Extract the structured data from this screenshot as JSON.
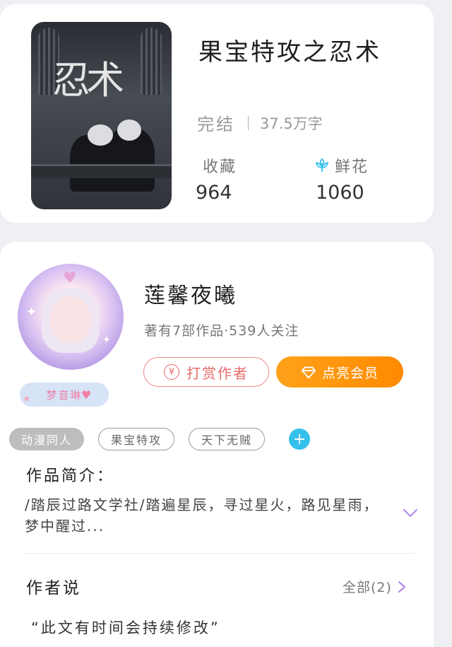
{
  "book": {
    "title": "果宝特攻之忍术",
    "status": "完结",
    "word_count": "37.5万字",
    "favorites_label": "收藏",
    "favorites_count": "964",
    "flowers_label": "鲜花",
    "flowers_count": "1060",
    "cover_title": "忍术"
  },
  "author": {
    "name": "莲馨夜曦",
    "meta": "著有7部作品·539人关注",
    "badge": "梦音琳",
    "tip_button": "打赏作者",
    "vip_button": "点亮会员"
  },
  "tags": [
    "动漫同人",
    "果宝特攻",
    "天下无贼"
  ],
  "intro": {
    "label": "作品简介：",
    "text": "/踏辰过路文学社/踏遍星辰，寻过星火，路见星雨，梦中醒过..."
  },
  "author_says": {
    "label": "作者说",
    "all_link": "全部(2)",
    "quote": "“此文有时间会持续修改”"
  },
  "colors": {
    "accent_orange": "#ff8a00",
    "tip_red": "#e86a6a",
    "add_blue": "#35c0ec",
    "expand_purple": "#b48be6"
  },
  "icons": [
    "flower-icon",
    "yen-icon",
    "diamond-icon",
    "plus-icon",
    "chevron-down-icon",
    "chevron-right-icon"
  ]
}
